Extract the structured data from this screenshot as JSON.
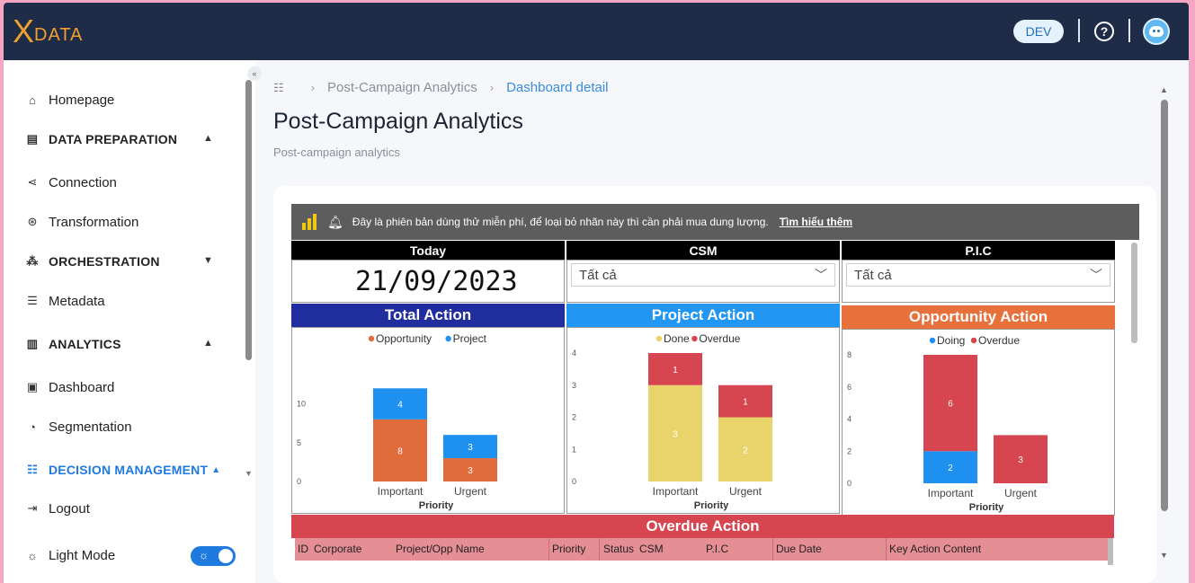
{
  "app": {
    "logo_x": "X",
    "logo_text": "DATA",
    "env_badge": "DEV",
    "help_icon": "help-circle-icon",
    "avatar_icon": "robot-avatar-icon"
  },
  "sidebar": {
    "items": [
      {
        "label": "Homepage",
        "icon": "home-icon",
        "type": "item"
      },
      {
        "label": "DATA PREPARATION",
        "icon": "database-icon",
        "type": "section",
        "chevron": "up"
      },
      {
        "label": "Connection",
        "icon": "share-nodes-icon",
        "type": "item"
      },
      {
        "label": "Transformation",
        "icon": "transform-icon",
        "type": "item"
      },
      {
        "label": "ORCHESTRATION",
        "icon": "hierarchy-icon",
        "type": "section",
        "chevron": "down"
      },
      {
        "label": "Metadata",
        "icon": "list-icon",
        "type": "item"
      },
      {
        "label": "ANALYTICS",
        "icon": "analytics-icon",
        "type": "section",
        "chevron": "up"
      },
      {
        "label": "Dashboard",
        "icon": "dashboard-icon",
        "type": "item"
      },
      {
        "label": "Segmentation",
        "icon": "pie-icon",
        "type": "item"
      },
      {
        "label": "DECISION MANAGEMENT",
        "icon": "decision-icon",
        "type": "section",
        "chevron": "up",
        "active": true
      },
      {
        "label": "Logout",
        "icon": "logout-icon",
        "type": "item"
      },
      {
        "label": "Light Mode",
        "icon": "sun-icon",
        "type": "item"
      }
    ],
    "light_mode_on": true
  },
  "breadcrumb": {
    "items": [
      "Post-Campaign Analytics",
      "Dashboard detail"
    ]
  },
  "page": {
    "title": "Post-Campaign Analytics",
    "subtitle": "Post-campaign analytics"
  },
  "banner": {
    "text": "Đây là phiên bản dùng thử miễn phí, để loại bỏ nhãn này thì cần phải mua dung lượng.",
    "link": "Tìm hiểu thêm"
  },
  "report": {
    "today_label": "Today",
    "today_value": "21/09/2023",
    "csm_label": "CSM",
    "csm_value": "Tất cả",
    "pic_label": "P.I.C",
    "pic_value": "Tất cả",
    "overdue_title": "Overdue Action",
    "overdue_columns": [
      "ID",
      "Corporate",
      "Project/Opp Name",
      "Priority",
      "Status",
      "CSM",
      "P.I.C",
      "Due Date",
      "Key Action Content"
    ]
  },
  "colors": {
    "total_header": "#1f2d9e",
    "project_header": "#2196f3",
    "opportunity_header": "#e8703a",
    "opportunity": "#e06c3c",
    "project": "#1e90f0",
    "done": "#e8d46a",
    "overdue": "#d64550",
    "doing": "#1e90f0"
  },
  "chart_data": [
    {
      "type": "bar",
      "title": "Total Action",
      "xlabel": "Priority",
      "categories": [
        "Important",
        "Urgent"
      ],
      "series": [
        {
          "name": "Opportunity",
          "values": [
            8,
            3
          ]
        },
        {
          "name": "Project",
          "values": [
            4,
            3
          ]
        }
      ],
      "ylim": [
        0,
        14
      ],
      "yticks": [
        0,
        5,
        10
      ],
      "stacked": true
    },
    {
      "type": "bar",
      "title": "Project Action",
      "xlabel": "Priority",
      "categories": [
        "Important",
        "Urgent"
      ],
      "series": [
        {
          "name": "Done",
          "values": [
            3,
            2
          ]
        },
        {
          "name": "Overdue",
          "values": [
            1,
            1
          ]
        }
      ],
      "ylim": [
        0,
        4
      ],
      "yticks": [
        0,
        1,
        2,
        3,
        4
      ],
      "stacked": true
    },
    {
      "type": "bar",
      "title": "Opportunity Action",
      "xlabel": "Priority",
      "categories": [
        "Important",
        "Urgent"
      ],
      "series": [
        {
          "name": "Doing",
          "values": [
            2,
            0
          ]
        },
        {
          "name": "Overdue",
          "values": [
            6,
            3
          ]
        }
      ],
      "ylim": [
        0,
        8
      ],
      "yticks": [
        0,
        2,
        4,
        6,
        8
      ],
      "stacked": true
    }
  ]
}
